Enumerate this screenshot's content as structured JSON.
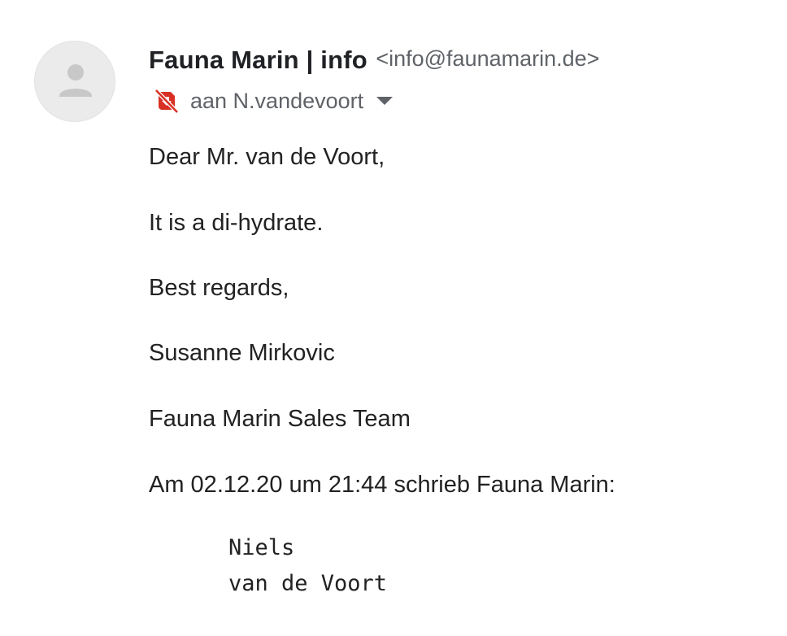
{
  "sender": {
    "name": "Fauna Marin | info",
    "email": "<info@faunamarin.de>"
  },
  "recipient": {
    "label": "aan N.vandevoort"
  },
  "message": {
    "greeting": "Dear Mr. van de Voort,",
    "line1": "It is a di-hydrate.",
    "closing": "Best regards,",
    "signature_name": "Susanne Mirkovic",
    "signature_team": "Fauna Marin Sales Team",
    "quote_header": "Am 02.12.20 um 21:44 schrieb Fauna Marin:",
    "quoted_line1": "Niels",
    "quoted_line2": "van de Voort"
  },
  "icons": {
    "avatar": "person-icon",
    "recipient": "unsubscribe-bell-icon",
    "dropdown": "triangle-down-icon"
  },
  "colors": {
    "icon_red": "#d93025",
    "secondary_text": "#5f6368",
    "avatar_bg": "#ebebeb",
    "avatar_fg": "#c4c4c4"
  }
}
